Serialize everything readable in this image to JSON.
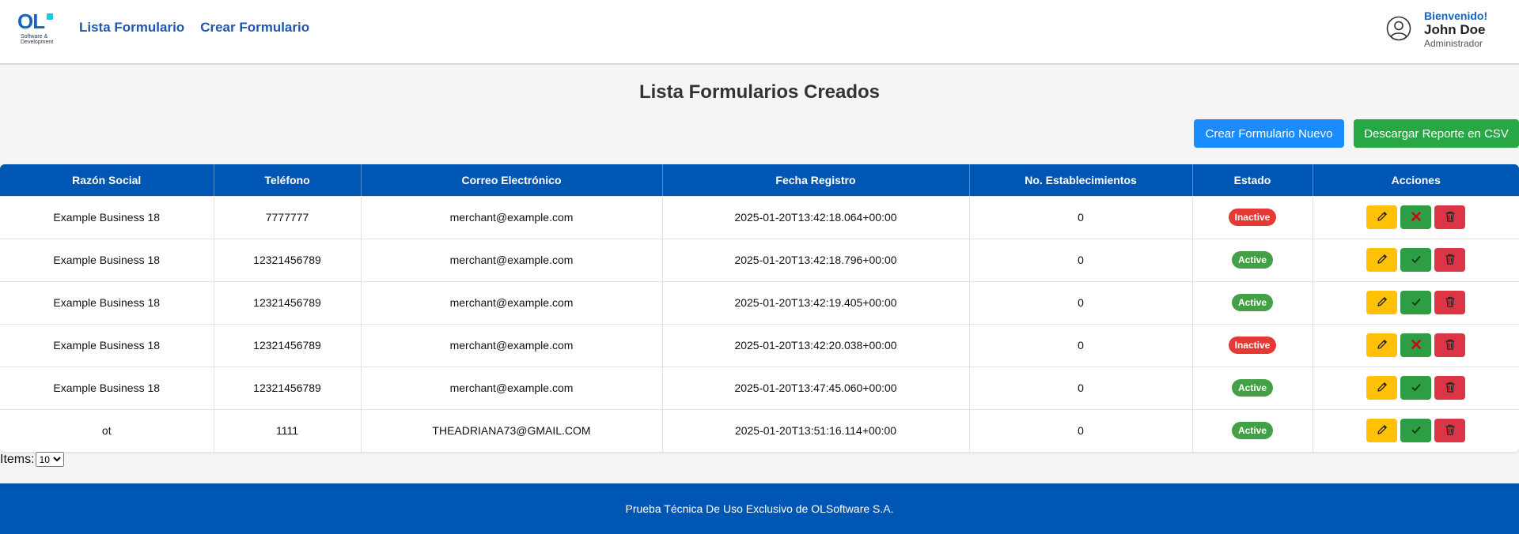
{
  "brand": {
    "logo_text": "OL",
    "logo_sub": "Software & Development"
  },
  "nav": {
    "items": [
      {
        "label": "Lista Formulario"
      },
      {
        "label": "Crear Formulario"
      }
    ]
  },
  "user": {
    "welcome": "Bienvenido!",
    "name": "John Doe",
    "role": "Administrador"
  },
  "page": {
    "title": "Lista Formularios Creados"
  },
  "actions": {
    "new_label": "Crear Formulario Nuevo",
    "csv_label": "Descargar Reporte en CSV"
  },
  "table": {
    "headers": [
      "Razón Social",
      "Teléfono",
      "Correo Electrónico",
      "Fecha Registro",
      "No. Establecimientos",
      "Estado",
      "Acciones"
    ],
    "rows": [
      {
        "razon": "Example Business 18",
        "telefono": "7777777",
        "correo": "merchant@example.com",
        "fecha": "2025-01-20T13:42:18.064+00:00",
        "estab": "0",
        "estado": "Inactive"
      },
      {
        "razon": "Example Business 18",
        "telefono": "12321456789",
        "correo": "merchant@example.com",
        "fecha": "2025-01-20T13:42:18.796+00:00",
        "estab": "0",
        "estado": "Active"
      },
      {
        "razon": "Example Business 18",
        "telefono": "12321456789",
        "correo": "merchant@example.com",
        "fecha": "2025-01-20T13:42:19.405+00:00",
        "estab": "0",
        "estado": "Active"
      },
      {
        "razon": "Example Business 18",
        "telefono": "12321456789",
        "correo": "merchant@example.com",
        "fecha": "2025-01-20T13:42:20.038+00:00",
        "estab": "0",
        "estado": "Inactive"
      },
      {
        "razon": "Example Business 18",
        "telefono": "12321456789",
        "correo": "merchant@example.com",
        "fecha": "2025-01-20T13:47:45.060+00:00",
        "estab": "0",
        "estado": "Active"
      },
      {
        "razon": "ot",
        "telefono": "1111",
        "correo": "THEADRIANA73@GMAIL.COM",
        "fecha": "2025-01-20T13:51:16.114+00:00",
        "estab": "0",
        "estado": "Active"
      }
    ]
  },
  "pagination": {
    "label": "Items:",
    "selected": "10"
  },
  "footer": {
    "text": "Prueba Técnica De Uso Exclusivo de OLSoftware S.A."
  },
  "colors": {
    "primary": "#0056b3",
    "nav": "#1f56b0",
    "active": "#43a047",
    "inactive": "#e53935",
    "edit": "#ffc107",
    "toggle": "#2e9e44",
    "delete": "#dc3545",
    "new_button": "#1a8cff",
    "csv_button": "#28a745"
  },
  "icons": {
    "edit": "pencil-icon",
    "activate": "check-icon",
    "deactivate": "x-icon",
    "delete": "trash-icon",
    "user": "user-circle-icon"
  }
}
